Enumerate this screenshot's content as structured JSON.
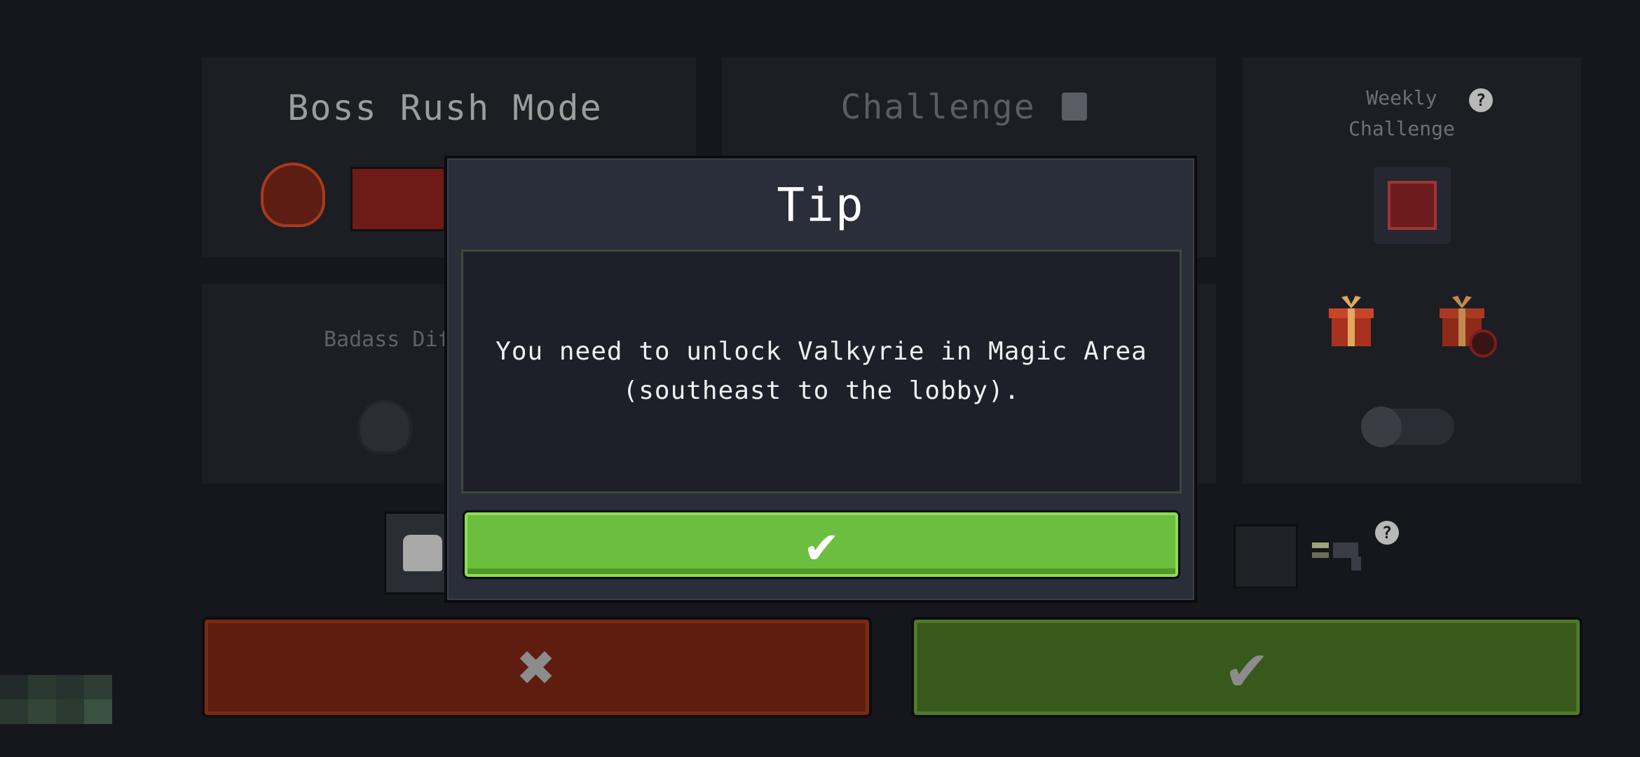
{
  "boss_rush": {
    "title": "Boss Rush Mode"
  },
  "challenge": {
    "title": "Challenge"
  },
  "weekly": {
    "title_line1": "Weekly",
    "title_line2": "Challenge"
  },
  "badass": {
    "label": "Badass Dif"
  },
  "tip_dialog": {
    "title": "Tip",
    "message_line1": "You need to unlock Valkyrie in Magic Area",
    "message_line2": "(southeast to the lobby).",
    "ok_icon": "✔"
  },
  "buttons": {
    "cancel_icon": "✖",
    "confirm_icon": "✔"
  },
  "help_icon": "?",
  "colors": {
    "accent_green": "#6cbf3e",
    "cancel_red": "#5e1d0e",
    "confirm_green": "#37591c",
    "background": "#15171c"
  }
}
